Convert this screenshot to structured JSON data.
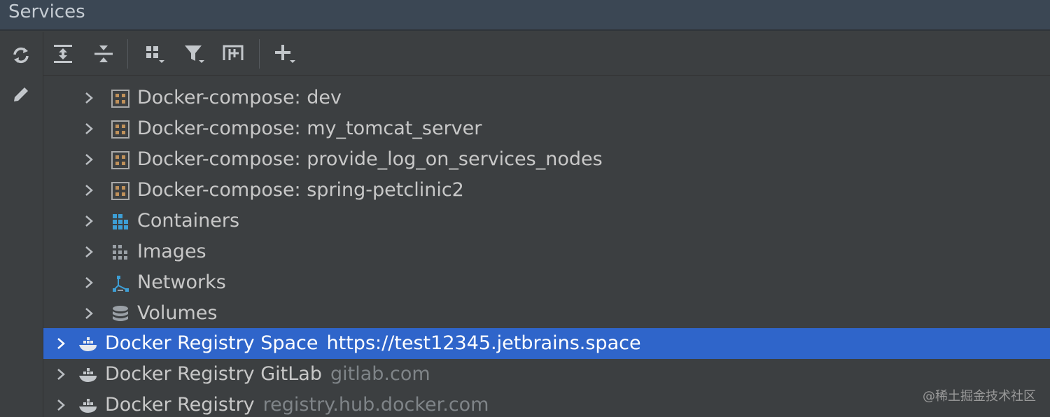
{
  "window": {
    "title": "Services"
  },
  "sidebar": {
    "refresh": {
      "icon": "refresh-icon"
    },
    "edit": {
      "icon": "pencil-icon"
    }
  },
  "toolbar": {
    "expand_all": {
      "icon": "expand-all-icon"
    },
    "collapse_all": {
      "icon": "collapse-all-icon"
    },
    "group_by": {
      "icon": "group-by-icon"
    },
    "filter": {
      "icon": "filter-icon"
    },
    "new_tab": {
      "icon": "open-in-new-tab-icon"
    },
    "add": {
      "icon": "add-icon"
    }
  },
  "tree": {
    "items": [
      {
        "label": "Docker-compose: dev",
        "icon": "compose-icon"
      },
      {
        "label": "Docker-compose: my_tomcat_server",
        "icon": "compose-icon"
      },
      {
        "label": "Docker-compose: provide_log_on_services_nodes",
        "icon": "compose-icon"
      },
      {
        "label": "Docker-compose: spring-petclinic2",
        "icon": "compose-icon"
      },
      {
        "label": "Containers",
        "icon": "containers-icon"
      },
      {
        "label": "Images",
        "icon": "images-icon"
      },
      {
        "label": "Networks",
        "icon": "networks-icon"
      },
      {
        "label": "Volumes",
        "icon": "volumes-icon"
      }
    ],
    "registries": [
      {
        "label": "Docker Registry Space",
        "url": "https://test12345.jetbrains.space",
        "selected": true,
        "icon": "docker-whale-icon"
      },
      {
        "label": "Docker Registry GitLab",
        "url": "gitlab.com",
        "selected": false,
        "icon": "docker-whale-icon"
      },
      {
        "label": "Docker Registry",
        "url": "registry.hub.docker.com",
        "selected": false,
        "icon": "docker-whale-icon"
      }
    ]
  },
  "watermark": "@稀土掘金技术社区",
  "colors": {
    "background": "#3c3f41",
    "title_bar": "#3b4754",
    "selection": "#2f65ca",
    "compose_icon": "#c0915a",
    "containers_icon": "#3d9fd6"
  }
}
